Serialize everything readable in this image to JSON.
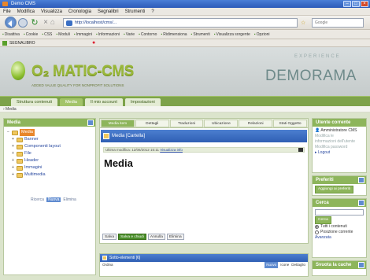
{
  "browser": {
    "title": "Demo CMS",
    "menu": [
      "File",
      "Modifica",
      "Visualizza",
      "Cronologia",
      "Segnalibri",
      "Strumenti",
      "?"
    ],
    "url": "http://localhost/cms/...",
    "search_placeholder": "Google",
    "toolbar_items": [
      "Disattiva",
      "Cookie",
      "CSS",
      "Moduli",
      "Immagini",
      "Informazioni",
      "Varie",
      "Contorno",
      "Ridimensiona",
      "Strumenti",
      "Visualizza sorgente",
      "Opzioni"
    ],
    "bookmark_label": "SEGNALIBRO"
  },
  "cms": {
    "logo": "O₂ MATIC-CMS",
    "logo_sub": "ADDED VALUE QUALITY FOR NONPROFIT SOLUTIONS",
    "slogan": "EXPERIENCE",
    "brand": "DEMORAMA",
    "nav": [
      "Struttura contenuti",
      "Media",
      "Il mio account",
      "Impostazioni"
    ],
    "nav_active": "Media",
    "breadcrumb": "› Media"
  },
  "left_panel": {
    "title": "Media",
    "tree": [
      {
        "label": "Media",
        "level": 0,
        "selected": true
      },
      {
        "label": "Banner",
        "level": 1
      },
      {
        "label": "Componenti layout",
        "level": 1
      },
      {
        "label": "File",
        "level": 1
      },
      {
        "label": "Header",
        "level": 1
      },
      {
        "label": "Immagini",
        "level": 1
      },
      {
        "label": "Multimedia",
        "level": 1
      }
    ],
    "actions": [
      "Ricerca",
      "Nuova",
      "Elimina"
    ]
  },
  "center": {
    "tabs": [
      "Media item",
      "Dettagli",
      "Traduzioni",
      "Ubicazione",
      "Relazioni",
      "Stati Oggetto"
    ],
    "active_tab": "Media item",
    "header": "Media [Cartella]",
    "modified": "Ultima modifica: 12/06/2012 15:11",
    "modified_link": "Visualizza info",
    "title": "Media",
    "actions": [
      "Salva",
      "Salva e chiudi",
      "Annulla",
      "Elimina"
    ]
  },
  "lower": {
    "header": "Sotto-elementi [6]",
    "row_left": "Ordina",
    "row_right": [
      "Nuovo",
      "Icone",
      "Dettaglio"
    ]
  },
  "right": {
    "utente": {
      "title": "Utente corrente",
      "name": "Amministratore CMS",
      "items": [
        "Modifica le",
        "informazioni dell'utente",
        "Modifica password"
      ],
      "logout": "Logout"
    },
    "preferiti": {
      "title": "Preferiti",
      "button": "Aggiungi ai preferiti"
    },
    "cerca": {
      "title": "Cerca",
      "button": "Cerca",
      "opt1": "Tutti i contenuti",
      "opt2": "Posizione corrente",
      "advanced": "Avanzata"
    },
    "cache": {
      "title": "Svuota la cache"
    }
  }
}
